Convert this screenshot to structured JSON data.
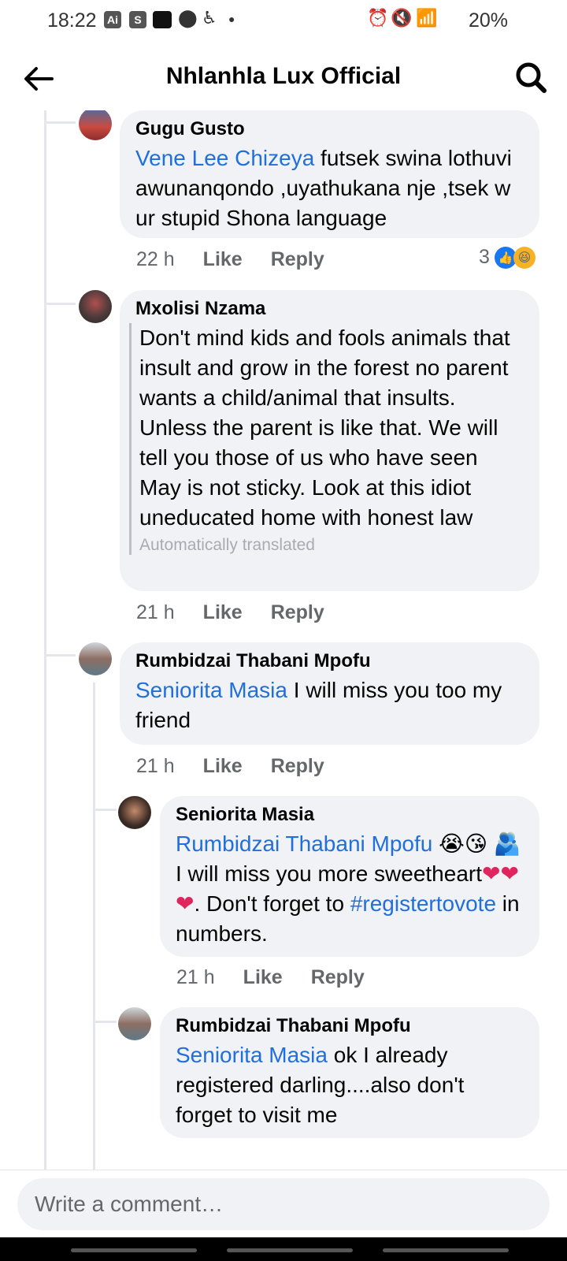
{
  "status_bar": {
    "time": "18:22",
    "icons": [
      "ai-icon",
      "s-icon",
      "app-icon",
      "location-icon",
      "accessibility-icon"
    ],
    "battery": "20%"
  },
  "header": {
    "title": "Nhlanhla Lux Official"
  },
  "comments": [
    {
      "author": "Gugu Gusto",
      "mention": "Vene Lee Chizeya",
      "text": " futsek swina lothuvi awunanqondo ,uyathukana nje ,tsek w ur stupid Shona language",
      "time": "22 h",
      "like": "Like",
      "reply": "Reply",
      "reaction_count": "3"
    },
    {
      "author": "Mxolisi Nzama",
      "text": "Don't mind kids and fools animals that insult and grow in the forest no parent wants a child/animal that insults. Unless the parent is like that. We will tell you those of us who have seen May is not sticky. Look at this idiot uneducated home with honest law",
      "translated_note": "Automatically translated",
      "time": "21 h",
      "like": "Like",
      "reply": "Reply"
    },
    {
      "author": "Rumbidzai Thabani Mpofu",
      "mention": "Seniorita Masia",
      "text": " I will miss you too my friend",
      "time": "21 h",
      "like": "Like",
      "reply": "Reply"
    },
    {
      "author": "Seniorita Masia",
      "mention": "Rumbidzai Thabani Mpofu",
      "text_part1": "I will miss you more sweetheart",
      "text_part2": ". Don't forget to ",
      "hashtag": "#registertovote",
      "text_part3": " in numbers.",
      "time": "21 h",
      "like": "Like",
      "reply": "Reply"
    },
    {
      "author": "Rumbidzai Thabani Mpofu",
      "mention": "Seniorita Masia",
      "text": " ok I already registered darling....also don't forget to visit me"
    }
  ],
  "composer": {
    "placeholder": "Write a comment…"
  },
  "colors": {
    "mention": "#216fdb",
    "bubble": "#f0f2f5",
    "meta": "#65676b"
  }
}
